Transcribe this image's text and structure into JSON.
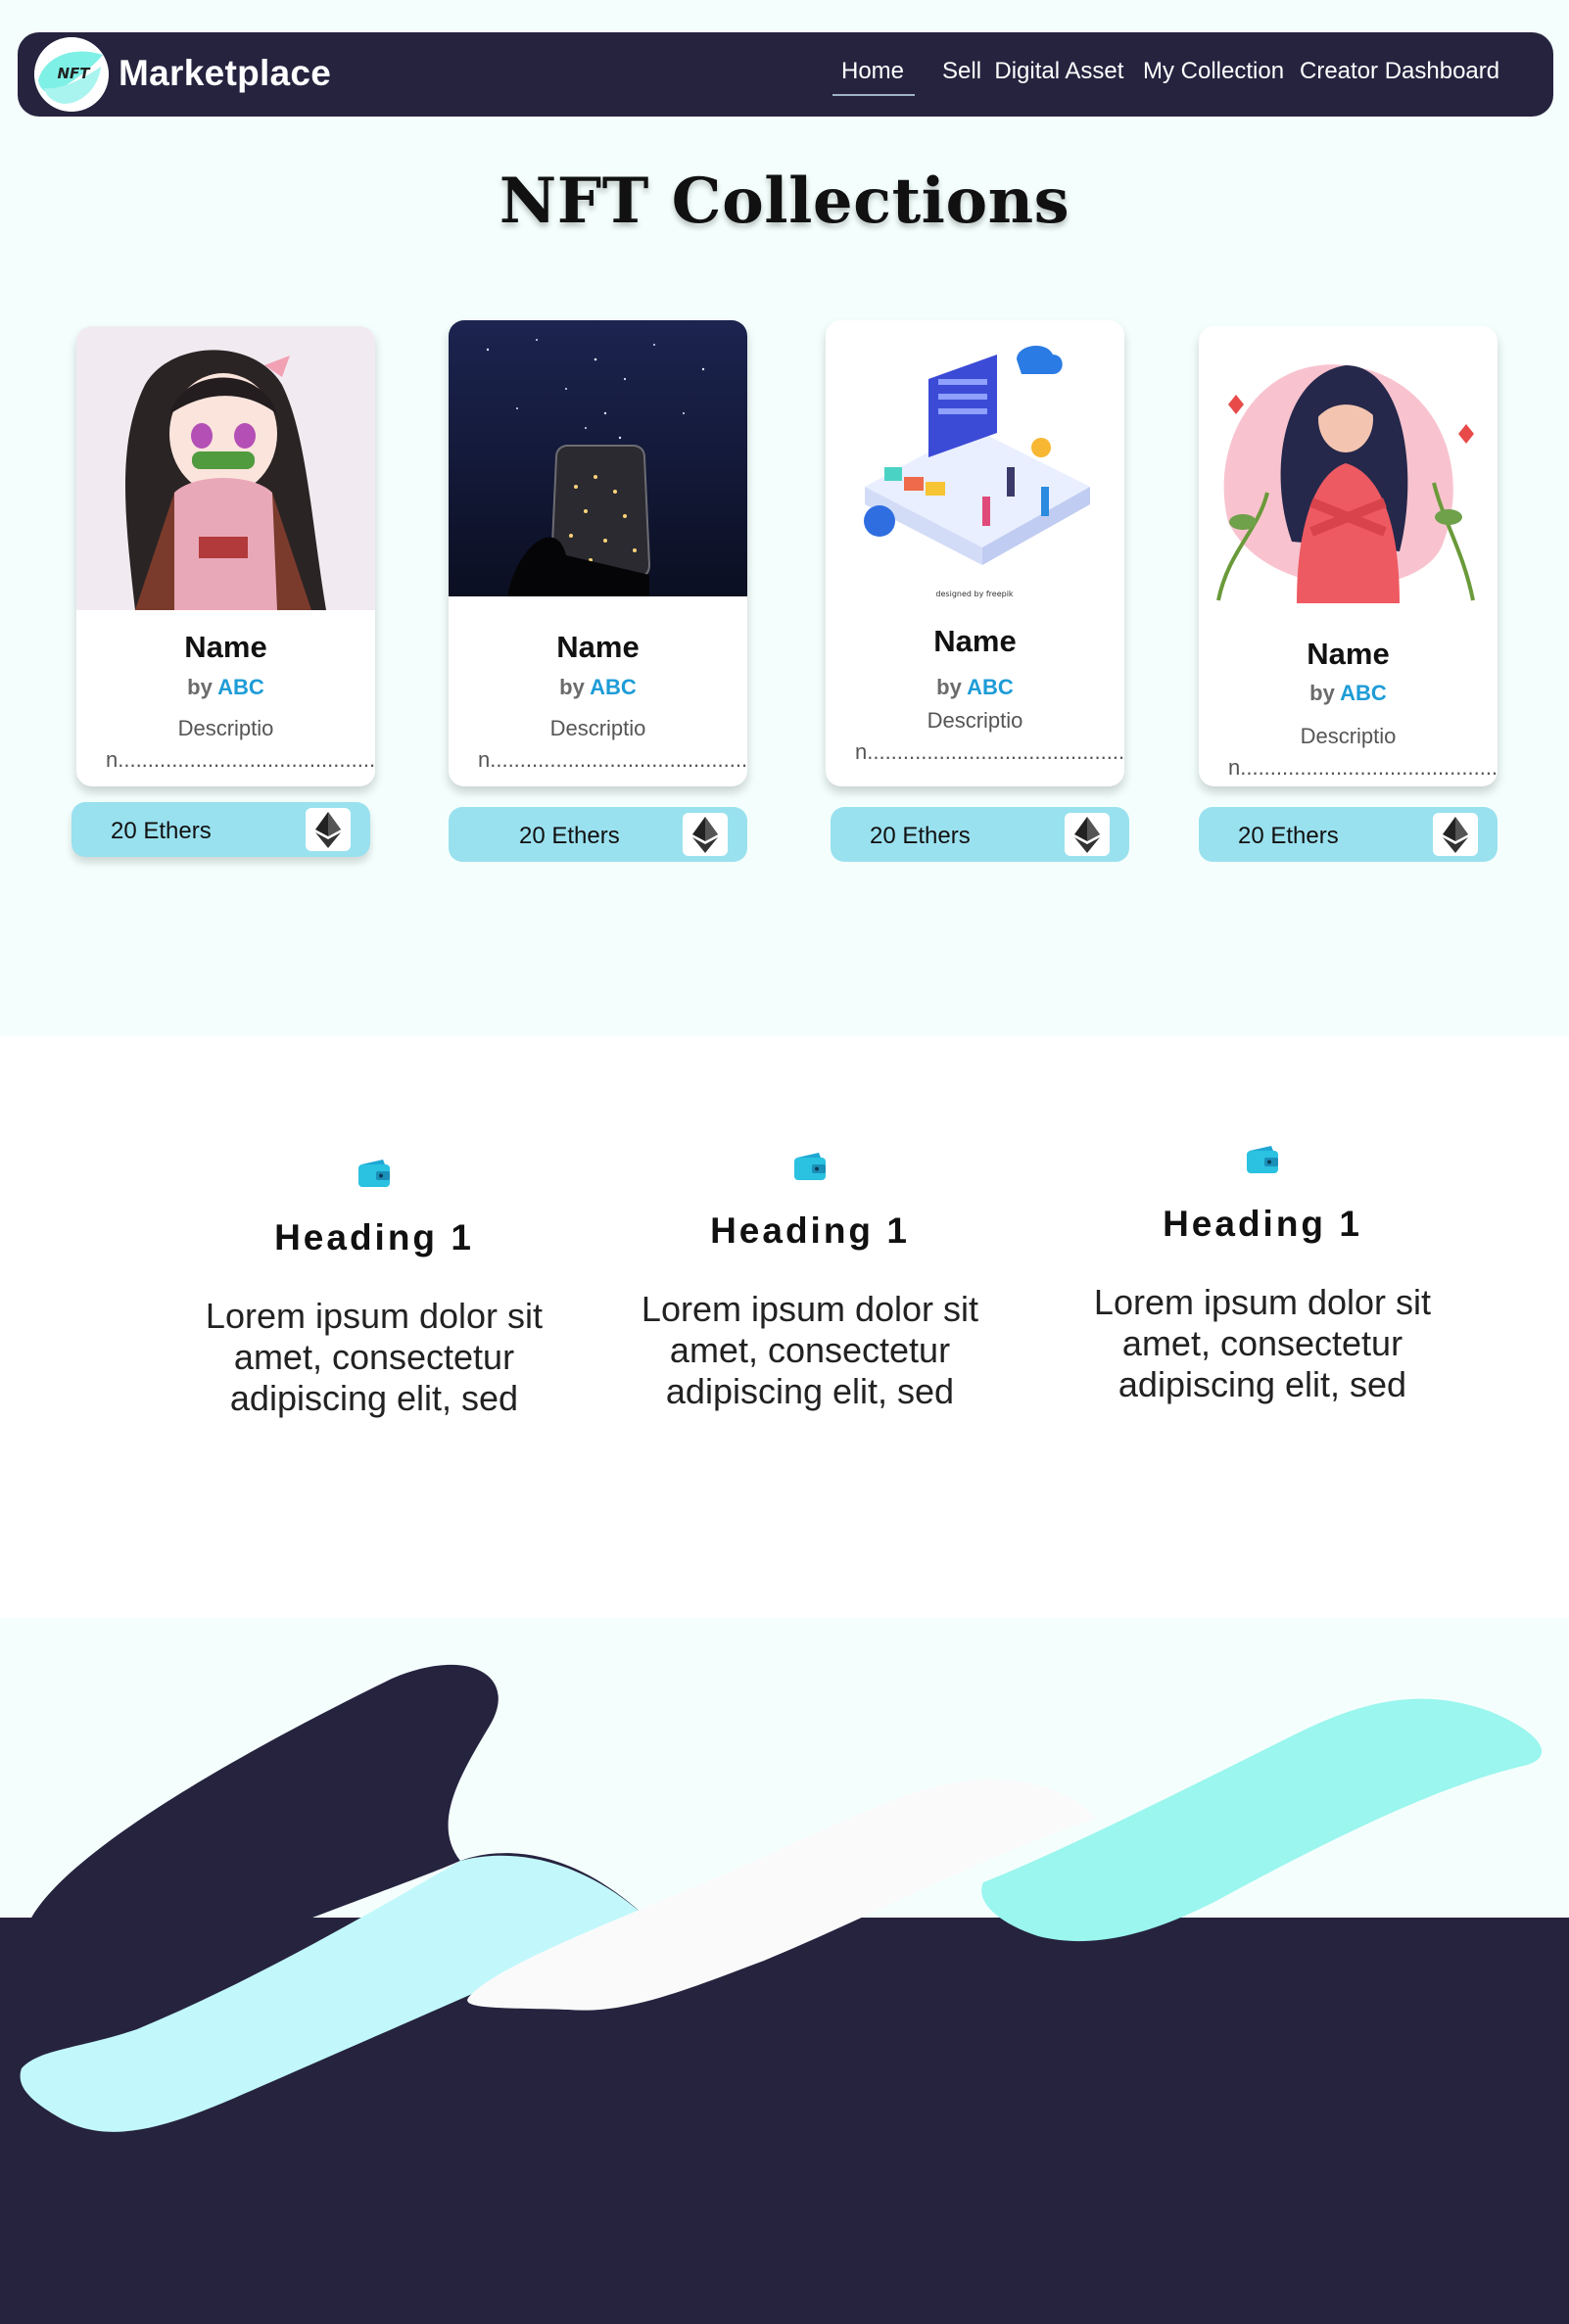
{
  "navbar": {
    "logo_text": "NFT",
    "brand": "Marketplace",
    "links": [
      "Home",
      "Sell  Digital Asset",
      "My Collection",
      "Creator Dashboard"
    ],
    "active": "Home"
  },
  "page_title": "NFT Collections",
  "cards": [
    {
      "name": "Name",
      "by": "by",
      "creator": "ABC",
      "description": "Description.....................................................",
      "price": "20 Ethers",
      "image": "anime-girl-illustration"
    },
    {
      "name": "Name",
      "by": "by",
      "creator": "ABC",
      "description": "Description.....................................................",
      "price": "20 Ethers",
      "image": "jar-of-lights-photo"
    },
    {
      "name": "Name",
      "by": "by",
      "creator": "ABC",
      "description": "Description.....................................................",
      "price": "20 Ethers",
      "image": "isometric-tech-illustration",
      "image_credit": "designed by freepik"
    },
    {
      "name": "Name",
      "by": "by",
      "creator": "ABC",
      "description": "Description.....................................................",
      "price": "20 Ethers",
      "image": "woman-flowers-illustration"
    }
  ],
  "features": [
    {
      "icon": "wallet-icon",
      "heading": "Heading 1",
      "text": "Lorem ipsum dolor sit amet, consectetur adipiscing elit, sed"
    },
    {
      "icon": "wallet-icon",
      "heading": "Heading 1",
      "text": "Lorem ipsum dolor sit amet, consectetur adipiscing elit, sed"
    },
    {
      "icon": "wallet-icon",
      "heading": "Heading 1",
      "text": "Lorem ipsum dolor sit amet, consectetur adipiscing elit, sed"
    }
  ],
  "colors": {
    "navbar": "#26233f",
    "page_bg": "#f4fffd",
    "price_bg": "#9ae1ef",
    "creator_link": "#1e9cd7",
    "wave_dark": "#26233f",
    "wave_light_cyan": "#c2f8fb",
    "wave_mint": "#9af6ee",
    "wave_white": "#fafafa"
  }
}
